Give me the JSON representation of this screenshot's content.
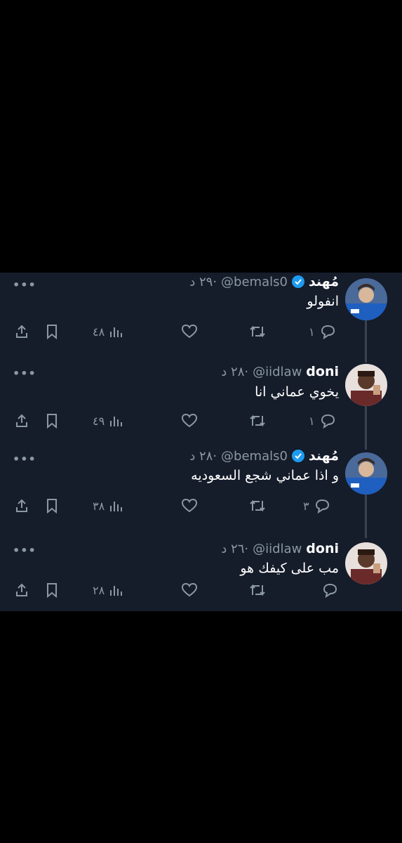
{
  "tweets": [
    {
      "name": "مُهند",
      "verified": true,
      "handle": "@bemals0",
      "meta": "·٢٩ د",
      "text": "انفولو",
      "replies": "١",
      "views": "٤٨",
      "avatar": "avatar-blue-jersey"
    },
    {
      "name": "doni",
      "verified": false,
      "handle": "@iidlaw",
      "meta": "·٢٨ د",
      "text": "يخوي عماني انا",
      "replies": "١",
      "views": "٤٩",
      "avatar": "avatar-man"
    },
    {
      "name": "مُهند",
      "verified": true,
      "handle": "@bemals0",
      "meta": "·٢٨ د",
      "text": "و اذا عماني شجع السعوديه",
      "replies": "٣",
      "views": "٣٨",
      "avatar": "avatar-blue-jersey"
    },
    {
      "name": "doni",
      "verified": false,
      "handle": "@iidlaw",
      "meta": "·٢٦ د",
      "text": "مب على كيفك هو",
      "replies": "",
      "views": "٢٨",
      "avatar": "avatar-man"
    }
  ],
  "colors": {
    "background": "#000000",
    "panel": "#151c2a",
    "muted": "#8b98a5",
    "verified": "#1d9bf0"
  },
  "icons": [
    "more-icon",
    "share-icon",
    "bookmark-icon",
    "views-icon",
    "like-icon",
    "retweet-icon",
    "reply-icon",
    "verified-badge-icon"
  ]
}
